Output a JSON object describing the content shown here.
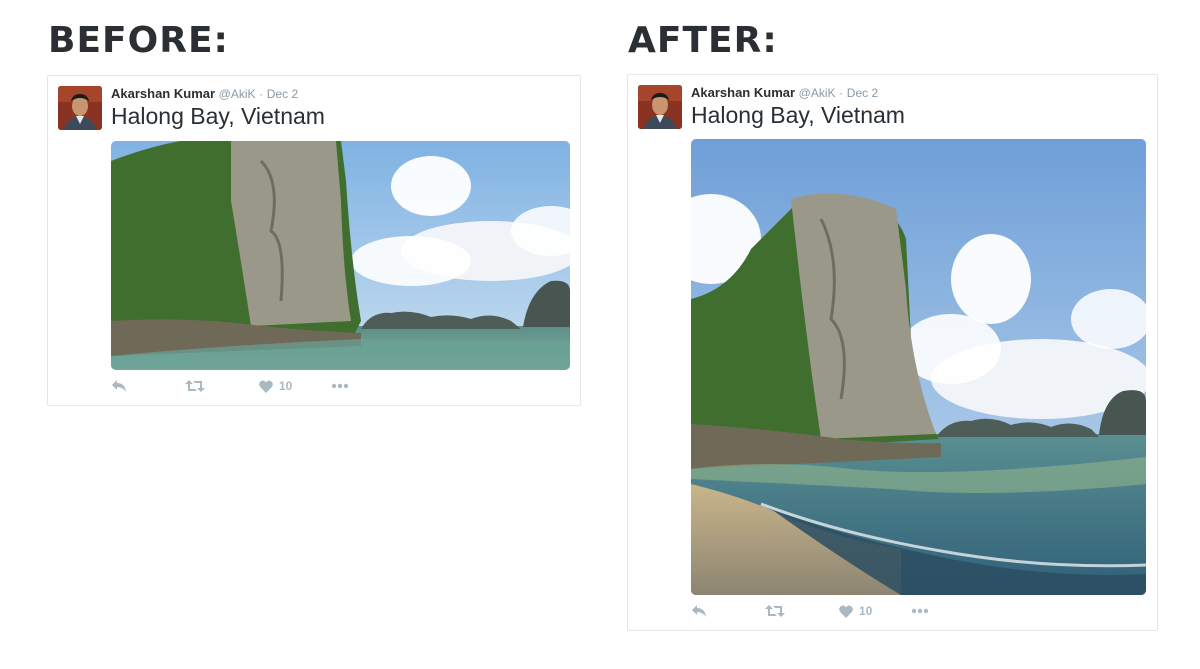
{
  "before": {
    "heading": "BEFORE:",
    "tweet": {
      "name": "Akarshan Kumar",
      "handle": "@AkiK",
      "separator": "·",
      "date": "Dec 2",
      "text": "Halong Bay, Vietnam",
      "likes": "10"
    }
  },
  "after": {
    "heading": "AFTER:",
    "tweet": {
      "name": "Akarshan Kumar",
      "handle": "@AkiK",
      "separator": "·",
      "date": "Dec 2",
      "text": "Halong Bay, Vietnam",
      "likes": "10"
    }
  },
  "icons": {
    "reply": "reply-icon",
    "retweet": "retweet-icon",
    "like": "heart-icon",
    "more": "more-icon"
  },
  "colors": {
    "icon_gray": "#aab8c2",
    "meta_gray": "#8899a6",
    "text": "#292f33",
    "border": "#e1e8ed"
  }
}
